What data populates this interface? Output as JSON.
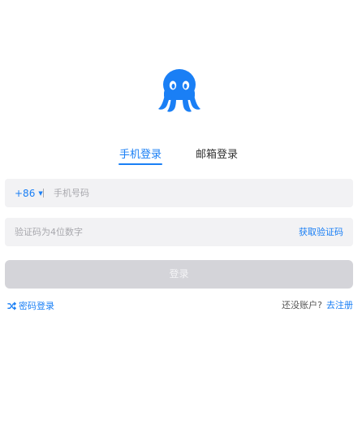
{
  "logo": {
    "icon": "octopus-logo-icon",
    "color": "#1a7ff5"
  },
  "tabs": [
    {
      "label": "手机登录",
      "active": true
    },
    {
      "label": "邮箱登录",
      "active": false
    }
  ],
  "phone_field": {
    "country_code": "+86",
    "caret_icon": "caret-down-icon",
    "value": "",
    "placeholder": "手机号码"
  },
  "code_field": {
    "value": "",
    "placeholder": "验证码为4位数字",
    "get_code_label": "获取验证码"
  },
  "login_button": {
    "label": "登录",
    "enabled": false
  },
  "footer": {
    "password_login_label": "密码登录",
    "password_login_icon": "shuffle-icon",
    "no_account_text": "还没账户?",
    "register_label": "去注册"
  },
  "colors": {
    "accent": "#1a7ff5",
    "field_bg": "#f2f2f4",
    "button_disabled_bg": "#d4d4d9"
  }
}
